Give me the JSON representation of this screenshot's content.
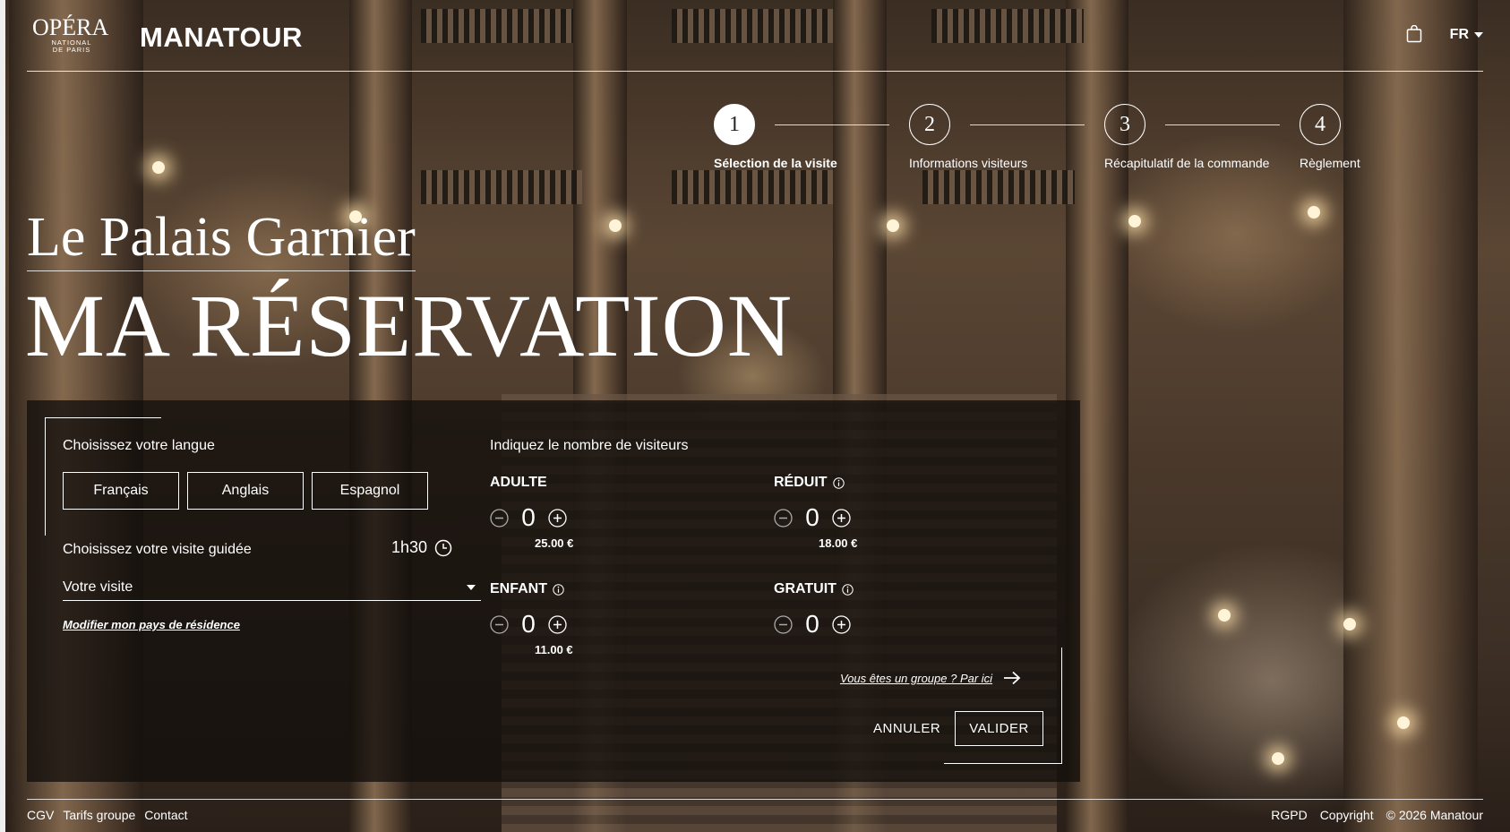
{
  "header": {
    "opera_logo_main": "OPÉRA",
    "opera_logo_sub": "NATIONAL DE PARIS",
    "brand": "MANATOUR",
    "language": "FR",
    "cart_icon": "shopping-bag-icon"
  },
  "steps": [
    {
      "number": "1",
      "label": "Sélection de la visite",
      "active": true
    },
    {
      "number": "2",
      "label": "Informations visiteurs",
      "active": false
    },
    {
      "number": "3",
      "label": "Récapitulatif de la commande",
      "active": false
    },
    {
      "number": "4",
      "label": "Règlement",
      "active": false
    }
  ],
  "hero": {
    "subtitle": "Le Palais Garnier",
    "title": "MA RÉSERVATION"
  },
  "booking": {
    "language_label": "Choisissez votre langue",
    "languages": [
      "Français",
      "Anglais",
      "Espagnol"
    ],
    "visit_label": "Choisissez votre visite guidée",
    "duration": "1h30",
    "visit_placeholder": "Votre visite",
    "country_link": "Modifier mon pays de résidence",
    "visitors_title": "Indiquez le nombre de visiteurs",
    "visitors": [
      {
        "name": "ADULTE",
        "count": "0",
        "price": "25.00 €",
        "info": false
      },
      {
        "name": "RÉDUIT",
        "count": "0",
        "price": "18.00 €",
        "info": true
      },
      {
        "name": "ENFANT",
        "count": "0",
        "price": "11.00 €",
        "info": true
      },
      {
        "name": "GRATUIT",
        "count": "0",
        "price": "",
        "info": true
      }
    ],
    "group_link": "Vous êtes un groupe ? Par ici",
    "cancel": "ANNULER",
    "validate": "VALIDER"
  },
  "footer": {
    "left": [
      "CGV",
      "Tarifs groupe",
      "Contact"
    ],
    "right": [
      "RGPD",
      "Copyright",
      "© 2026 Manatour"
    ]
  },
  "colors": {
    "text": "#ffffff",
    "panel": "#120e0c",
    "background": "#4a392b"
  }
}
